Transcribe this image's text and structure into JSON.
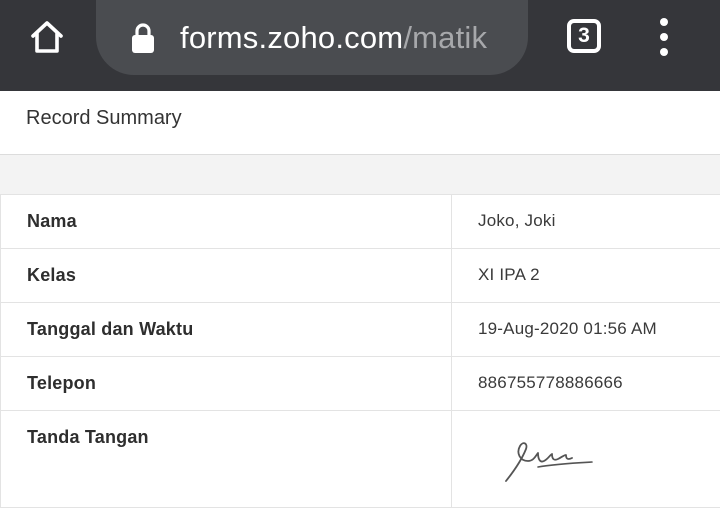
{
  "browser": {
    "url_domain": "forms.zoho.com",
    "url_path": "/matik",
    "tab_count": "3"
  },
  "summary": {
    "title": "Record Summary"
  },
  "records": [
    {
      "label": "Nama",
      "value": "Joko, Joki"
    },
    {
      "label": "Kelas",
      "value": "XI IPA 2"
    },
    {
      "label": "Tanggal dan Waktu",
      "value": "19-Aug-2020 01:56 AM"
    },
    {
      "label": "Telepon",
      "value": "886755778886666"
    },
    {
      "label": "Tanda Tangan",
      "value": ""
    }
  ],
  "icons": {
    "home": "home-icon",
    "lock": "lock-icon",
    "tabs": "tab-switcher-icon",
    "menu": "more-vert-icon"
  },
  "colors": {
    "toolbar": "#35363a",
    "urlbar": "#4a4c50",
    "url_path": "#a7a8ab"
  }
}
